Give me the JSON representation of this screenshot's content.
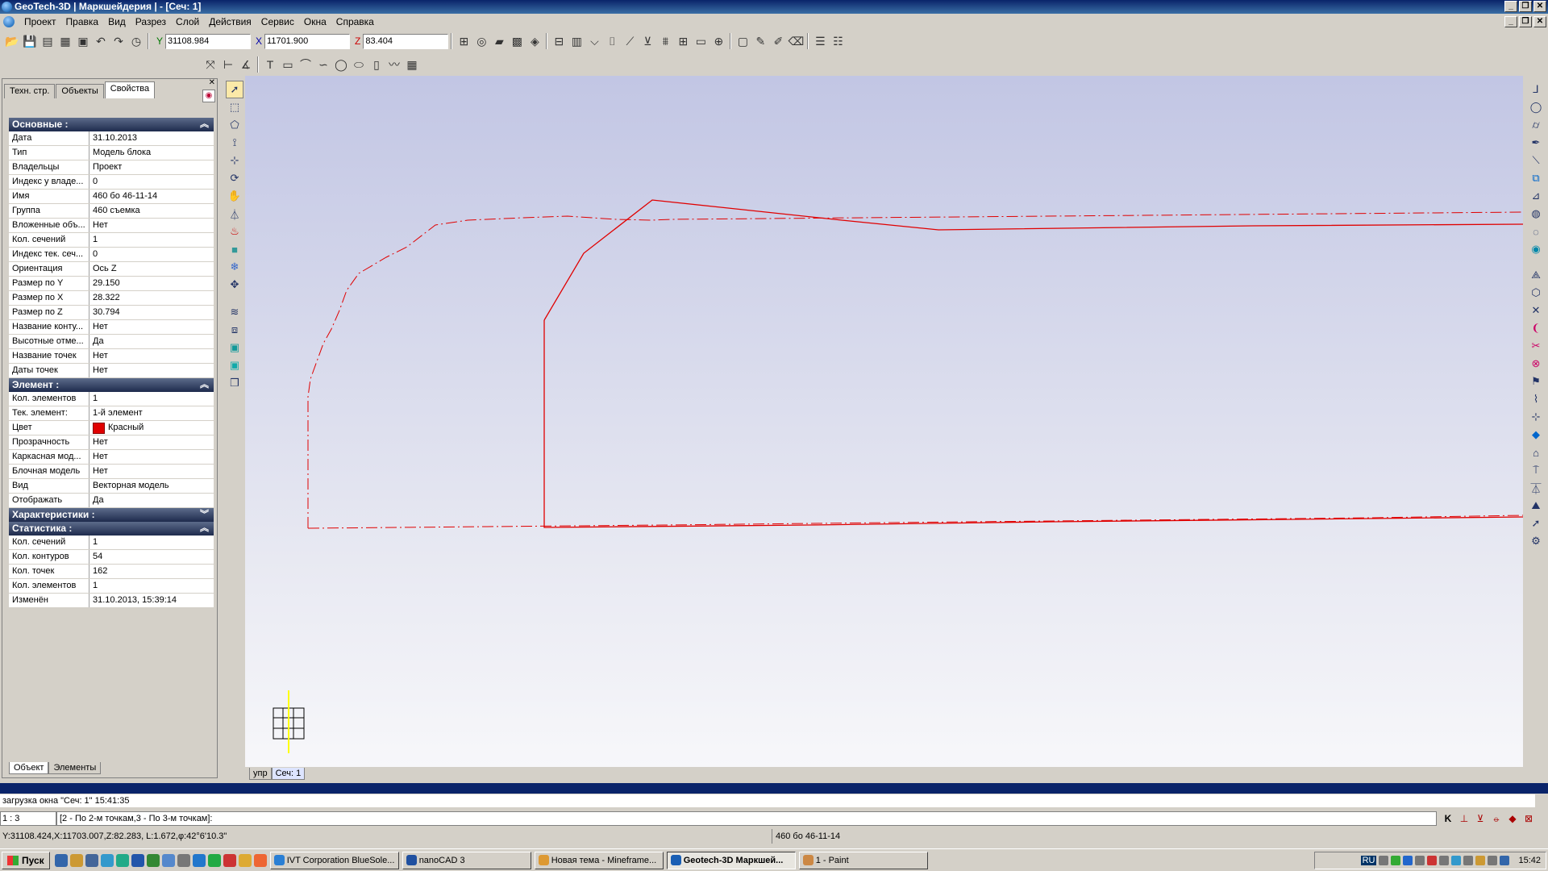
{
  "window": {
    "title": "GeoTech-3D | Маркшейдерия | - [Сеч: 1]"
  },
  "menu": [
    "Проект",
    "Правка",
    "Вид",
    "Разрез",
    "Слой",
    "Действия",
    "Сервис",
    "Окна",
    "Справка"
  ],
  "coords": {
    "y_label": "Y",
    "y_value": "31108.984",
    "x_label": "X",
    "x_value": "11701.900",
    "z_label": "Z",
    "z_value": "83.404"
  },
  "panel": {
    "tabs": [
      "Техн. стр.",
      "Объекты",
      "Свойства"
    ],
    "active_tab": "Свойства",
    "sections": [
      {
        "title": "Основные :",
        "collapsed": false,
        "rows": [
          {
            "k": "Дата",
            "v": "31.10.2013"
          },
          {
            "k": "Тип",
            "v": "Модель блока"
          },
          {
            "k": "Владельцы",
            "v": "Проект"
          },
          {
            "k": "Индекс у владе...",
            "v": "0"
          },
          {
            "k": "Имя",
            "v": "460 бо 46-11-14"
          },
          {
            "k": "Группа",
            "v": "460 съемка"
          },
          {
            "k": "Вложенные объ...",
            "v": "Нет"
          },
          {
            "k": "Кол. сечений",
            "v": "1"
          },
          {
            "k": "Индекс тек. сеч...",
            "v": "0"
          },
          {
            "k": "Ориентация",
            "v": "Ось Z"
          },
          {
            "k": "Размер по Y",
            "v": "29.150"
          },
          {
            "k": "Размер по X",
            "v": "28.322"
          },
          {
            "k": "Размер по Z",
            "v": "30.794"
          },
          {
            "k": "Название конту...",
            "v": "Нет"
          },
          {
            "k": "Высотные отме...",
            "v": "Да"
          },
          {
            "k": "Название точек",
            "v": "Нет"
          },
          {
            "k": "Даты точек",
            "v": "Нет"
          }
        ]
      },
      {
        "title": "Элемент :",
        "collapsed": false,
        "rows": [
          {
            "k": "Кол. элементов",
            "v": "1"
          },
          {
            "k": "Тек. элемент:",
            "v": "1-й элемент"
          },
          {
            "k": "Цвет",
            "v": "Красный",
            "swatch": "#e00000"
          },
          {
            "k": "Прозрачность",
            "v": "Нет"
          },
          {
            "k": "Каркасная мод...",
            "v": "Нет"
          },
          {
            "k": "Блочная модель",
            "v": "Нет"
          },
          {
            "k": "Вид",
            "v": "Векторная модель"
          },
          {
            "k": "Отображать",
            "v": "Да"
          }
        ]
      },
      {
        "title": "Характеристики :",
        "collapsed": true,
        "rows": []
      },
      {
        "title": "Статистика :",
        "collapsed": false,
        "rows": [
          {
            "k": "Кол. сечений",
            "v": "1"
          },
          {
            "k": "Кол. контуров",
            "v": "54"
          },
          {
            "k": "Кол. точек",
            "v": "162"
          },
          {
            "k": "Кол. элементов",
            "v": "1"
          },
          {
            "k": "Изменён",
            "v": "31.10.2013, 15:39:14"
          }
        ]
      }
    ],
    "bottom_tabs": [
      "Объект",
      "Элементы"
    ]
  },
  "doc_tabs": [
    "упр",
    "Сеч: 1"
  ],
  "command": {
    "log": "загрузка окна \"Сеч: 1\" 15:41:35",
    "scale": "1 : 3",
    "prompt": "[2 - По 2-м точкам,3 - По 3-м точкам]:"
  },
  "status": {
    "cursor": "Y:31108.424,X:11703.007,Z:82.283, L:1.672,φ:42°6'10.3\"",
    "object": "460 бо 46-11-14"
  },
  "taskbar": {
    "start": "Пуск",
    "tasks": [
      {
        "label": "IVT Corporation BlueSole...",
        "color": "#2a7fd4",
        "active": false
      },
      {
        "label": "nanoCAD 3",
        "color": "#2050a0",
        "active": false
      },
      {
        "label": "Новая тема - Mineframe...",
        "color": "#d93",
        "active": false
      },
      {
        "label": "Geotech-3D Маркшей...",
        "color": "#1a5fb4",
        "active": true
      },
      {
        "label": "1 - Paint",
        "color": "#c84",
        "active": false
      }
    ],
    "clock": "15:42",
    "lang": "RU"
  },
  "colors": {
    "contour": "#e00000",
    "title_bar": "#0a246a"
  }
}
